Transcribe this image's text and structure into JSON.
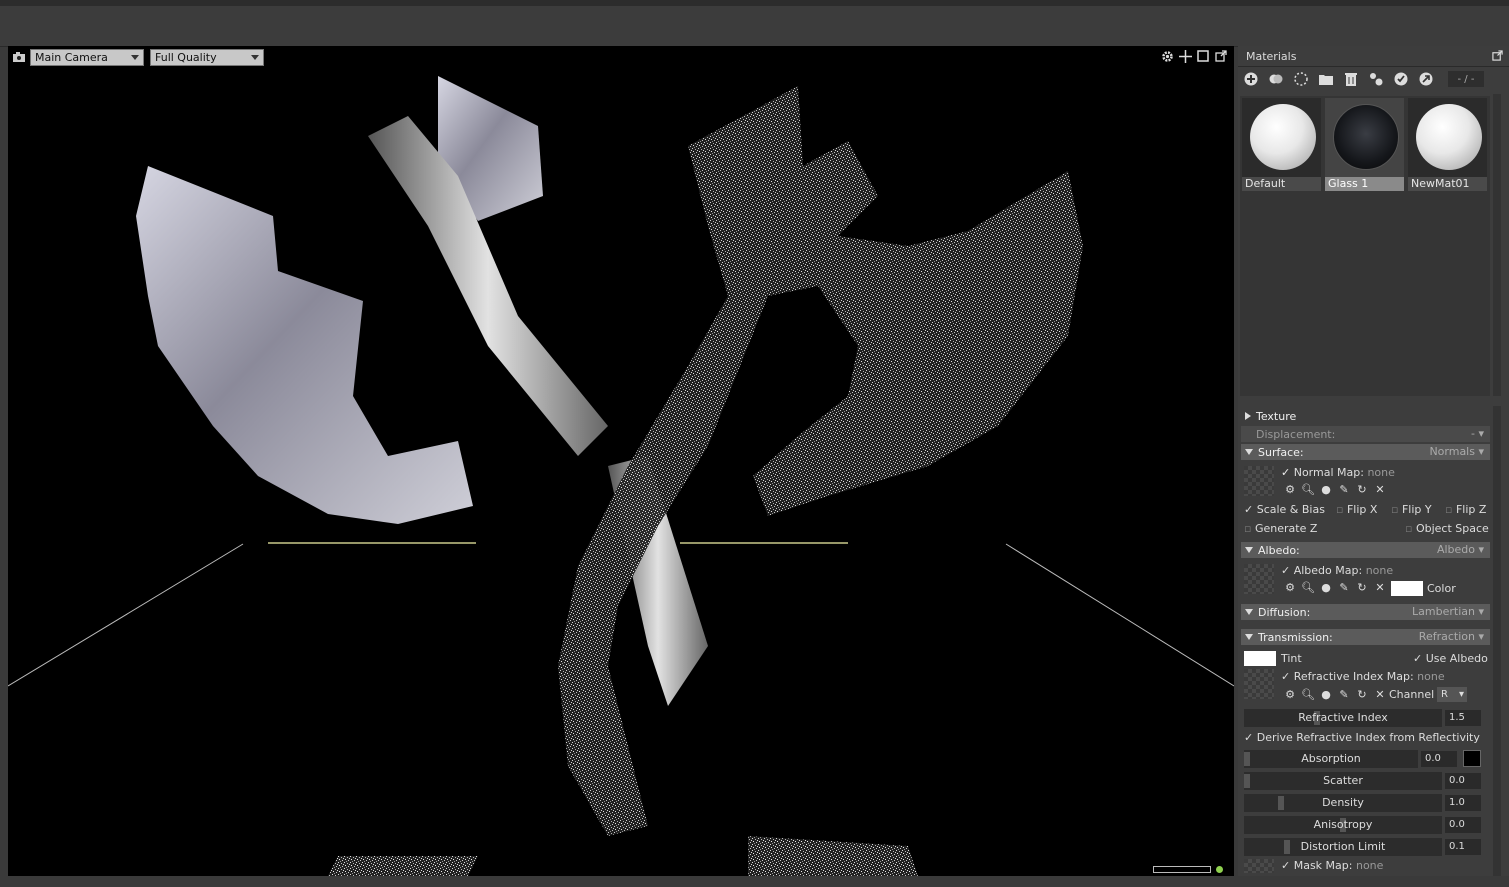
{
  "viewport": {
    "camera": "Main Camera",
    "quality": "Full Quality",
    "tool_icons": [
      "settings-icon",
      "move-icon",
      "frame-icon",
      "popout-icon"
    ]
  },
  "panel": {
    "title": "Materials",
    "counter": "- / -",
    "toolbar_icons": [
      "add-icon",
      "duplicate-icon",
      "checker-icon",
      "folder-icon",
      "trash-icon",
      "share-icon",
      "apply-icon",
      "reset-icon"
    ],
    "materials": [
      {
        "name": "Default"
      },
      {
        "name": "Glass 1"
      },
      {
        "name": "NewMat01"
      }
    ]
  },
  "props": {
    "texture": "Texture",
    "displacement": "Displacement:",
    "displacement_mode": "- ▾",
    "surface": "Surface:",
    "surface_mode": "Normals ▾",
    "normal_map": "Normal Map:",
    "normal_map_val": "none",
    "scale_bias": "Scale & Bias",
    "flip_x": "Flip X",
    "flip_y": "Flip Y",
    "flip_z": "Flip Z",
    "generate_z": "Generate Z",
    "object_space": "Object Space",
    "albedo": "Albedo:",
    "albedo_mode": "Albedo ▾",
    "albedo_map": "Albedo Map:",
    "albedo_map_val": "none",
    "color": "Color",
    "diffusion": "Diffusion:",
    "diffusion_mode": "Lambertian ▾",
    "transmission": "Transmission:",
    "transmission_mode": "Refraction ▾",
    "tint": "Tint",
    "use_albedo": "Use Albedo",
    "refr_map": "Refractive Index Map:",
    "refr_map_val": "none",
    "channel": "Channel",
    "channel_val": "R",
    "refr_index": "Refractive Index",
    "refr_index_val": "1.5",
    "derive": "Derive Refractive Index from Reflectivity",
    "absorption": "Absorption",
    "absorption_val": "0.0",
    "scatter": "Scatter",
    "scatter_val": "0.0",
    "density": "Density",
    "density_val": "1.0",
    "anisotropy": "Anisotropy",
    "anisotropy_val": "0.0",
    "distortion": "Distortion Limit",
    "distortion_val": "0.1",
    "mask_map": "Mask Map:",
    "mask_map_val": "none"
  }
}
